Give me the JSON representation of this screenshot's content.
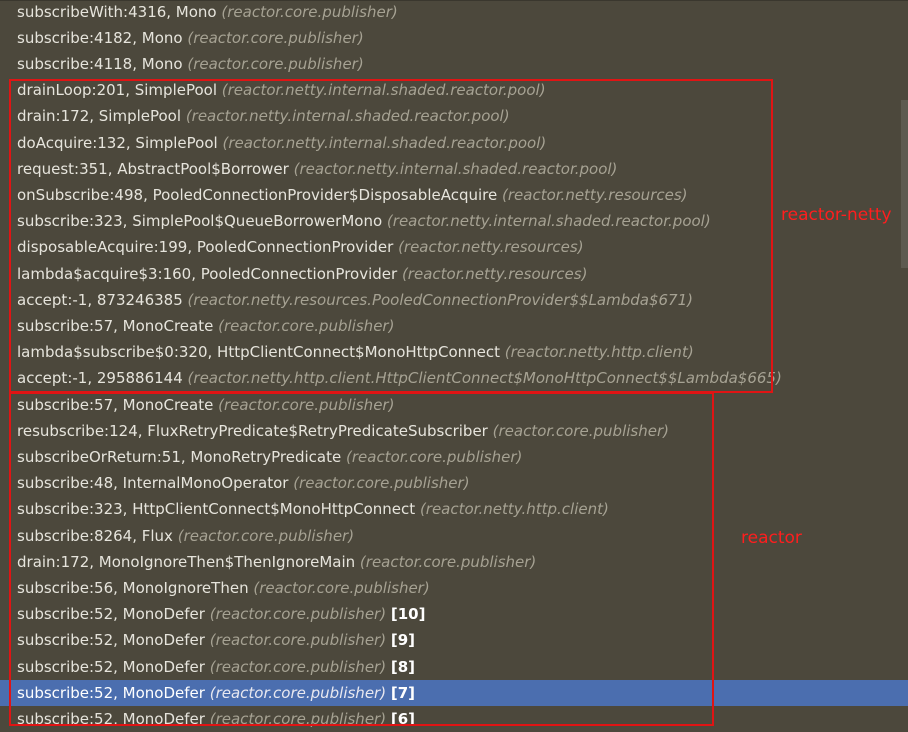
{
  "frames": [
    {
      "method": "subscribeWith:4316, Mono",
      "pkg": "(reactor.core.publisher)",
      "count": ""
    },
    {
      "method": "subscribe:4182, Mono",
      "pkg": "(reactor.core.publisher)",
      "count": ""
    },
    {
      "method": "subscribe:4118, Mono",
      "pkg": "(reactor.core.publisher)",
      "count": ""
    },
    {
      "method": "drainLoop:201, SimplePool",
      "pkg": "(reactor.netty.internal.shaded.reactor.pool)",
      "count": ""
    },
    {
      "method": "drain:172, SimplePool",
      "pkg": "(reactor.netty.internal.shaded.reactor.pool)",
      "count": ""
    },
    {
      "method": "doAcquire:132, SimplePool",
      "pkg": "(reactor.netty.internal.shaded.reactor.pool)",
      "count": ""
    },
    {
      "method": "request:351, AbstractPool$Borrower",
      "pkg": "(reactor.netty.internal.shaded.reactor.pool)",
      "count": ""
    },
    {
      "method": "onSubscribe:498, PooledConnectionProvider$DisposableAcquire",
      "pkg": "(reactor.netty.resources)",
      "count": ""
    },
    {
      "method": "subscribe:323, SimplePool$QueueBorrowerMono",
      "pkg": "(reactor.netty.internal.shaded.reactor.pool)",
      "count": ""
    },
    {
      "method": "disposableAcquire:199, PooledConnectionProvider",
      "pkg": "(reactor.netty.resources)",
      "count": ""
    },
    {
      "method": "lambda$acquire$3:160, PooledConnectionProvider",
      "pkg": "(reactor.netty.resources)",
      "count": ""
    },
    {
      "method": "accept:-1, 873246385",
      "pkg": "(reactor.netty.resources.PooledConnectionProvider$$Lambda$671)",
      "count": ""
    },
    {
      "method": "subscribe:57, MonoCreate",
      "pkg": "(reactor.core.publisher)",
      "count": ""
    },
    {
      "method": "lambda$subscribe$0:320, HttpClientConnect$MonoHttpConnect",
      "pkg": "(reactor.netty.http.client)",
      "count": ""
    },
    {
      "method": "accept:-1, 295886144",
      "pkg": "(reactor.netty.http.client.HttpClientConnect$MonoHttpConnect$$Lambda$665)",
      "count": ""
    },
    {
      "method": "subscribe:57, MonoCreate",
      "pkg": "(reactor.core.publisher)",
      "count": ""
    },
    {
      "method": "resubscribe:124, FluxRetryPredicate$RetryPredicateSubscriber",
      "pkg": "(reactor.core.publisher)",
      "count": ""
    },
    {
      "method": "subscribeOrReturn:51, MonoRetryPredicate",
      "pkg": "(reactor.core.publisher)",
      "count": ""
    },
    {
      "method": "subscribe:48, InternalMonoOperator",
      "pkg": "(reactor.core.publisher)",
      "count": ""
    },
    {
      "method": "subscribe:323, HttpClientConnect$MonoHttpConnect",
      "pkg": "(reactor.netty.http.client)",
      "count": ""
    },
    {
      "method": "subscribe:8264, Flux",
      "pkg": "(reactor.core.publisher)",
      "count": ""
    },
    {
      "method": "drain:172, MonoIgnoreThen$ThenIgnoreMain",
      "pkg": "(reactor.core.publisher)",
      "count": ""
    },
    {
      "method": "subscribe:56, MonoIgnoreThen",
      "pkg": "(reactor.core.publisher)",
      "count": ""
    },
    {
      "method": "subscribe:52, MonoDefer",
      "pkg": "(reactor.core.publisher)",
      "count": "[10]"
    },
    {
      "method": "subscribe:52, MonoDefer",
      "pkg": "(reactor.core.publisher)",
      "count": "[9]"
    },
    {
      "method": "subscribe:52, MonoDefer",
      "pkg": "(reactor.core.publisher)",
      "count": "[8]"
    },
    {
      "method": "subscribe:52, MonoDefer",
      "pkg": "(reactor.core.publisher)",
      "count": "[7]"
    },
    {
      "method": "subscribe:52, MonoDefer",
      "pkg": "(reactor.core.publisher)",
      "count": "[6]"
    }
  ],
  "selected_frame_index": 26,
  "annotations": {
    "netty_label": "reactor-netty",
    "reactor_label": "reactor"
  },
  "colors": {
    "background": "#4c483c",
    "selection": "#4b6eaf",
    "annotation": "#e01414"
  }
}
